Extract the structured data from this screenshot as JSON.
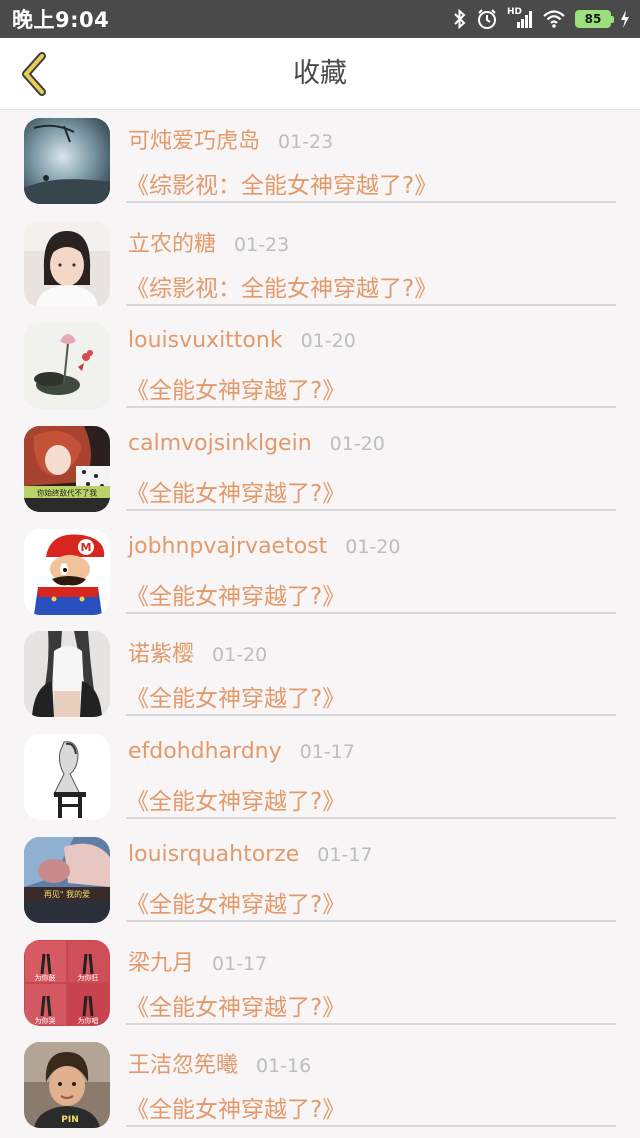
{
  "status_bar": {
    "time": "晚上9:04",
    "signal_label": "HD",
    "battery_level": "85",
    "icons": [
      "bluetooth-icon",
      "alarm-icon",
      "signal-icon",
      "wifi-icon",
      "battery-icon",
      "charging-icon"
    ]
  },
  "nav": {
    "back_icon": "chevron-left-icon",
    "title": "收藏",
    "accent_color": "#e0b23a"
  },
  "items": [
    {
      "name": "可炖爱巧虎岛",
      "date": "01-23",
      "book": "《综影视：全能女神穿越了?》"
    },
    {
      "name": "立农的糖",
      "date": "01-23",
      "book": "《综影视：全能女神穿越了?》"
    },
    {
      "name": "louisvuxittonk",
      "date": "01-20",
      "book": "《全能女神穿越了?》"
    },
    {
      "name": "calmvojsinklgein",
      "date": "01-20",
      "book": "《全能女神穿越了?》"
    },
    {
      "name": "jobhnpvajrvaetost",
      "date": "01-20",
      "book": "《全能女神穿越了?》"
    },
    {
      "name": "诺紫樱",
      "date": "01-20",
      "book": "《全能女神穿越了?》"
    },
    {
      "name": "efdohdhardny",
      "date": "01-17",
      "book": "《全能女神穿越了?》"
    },
    {
      "name": "louisrquahtorze",
      "date": "01-17",
      "book": "《全能女神穿越了?》"
    },
    {
      "name": "梁九月",
      "date": "01-17",
      "book": "《全能女神穿越了?》"
    },
    {
      "name": "王洁忽筅曦",
      "date": "01-16",
      "book": "《全能女神穿越了?》"
    }
  ],
  "avatar_texts": {
    "a4": "你始终敌代不了我",
    "a8": "再见\" 我的爱",
    "a9_1": "为你鼓",
    "a9_2": "为你狂",
    "a9_3": "为你哭",
    "a9_4": "为你唱",
    "a10": "PIN"
  },
  "colors": {
    "name_text": "#e39a6b",
    "date_text": "#bdbdbd",
    "divider": "#d9d6d8",
    "status_bar_bg": "#4a4a4a",
    "battery": "#9be07a"
  }
}
